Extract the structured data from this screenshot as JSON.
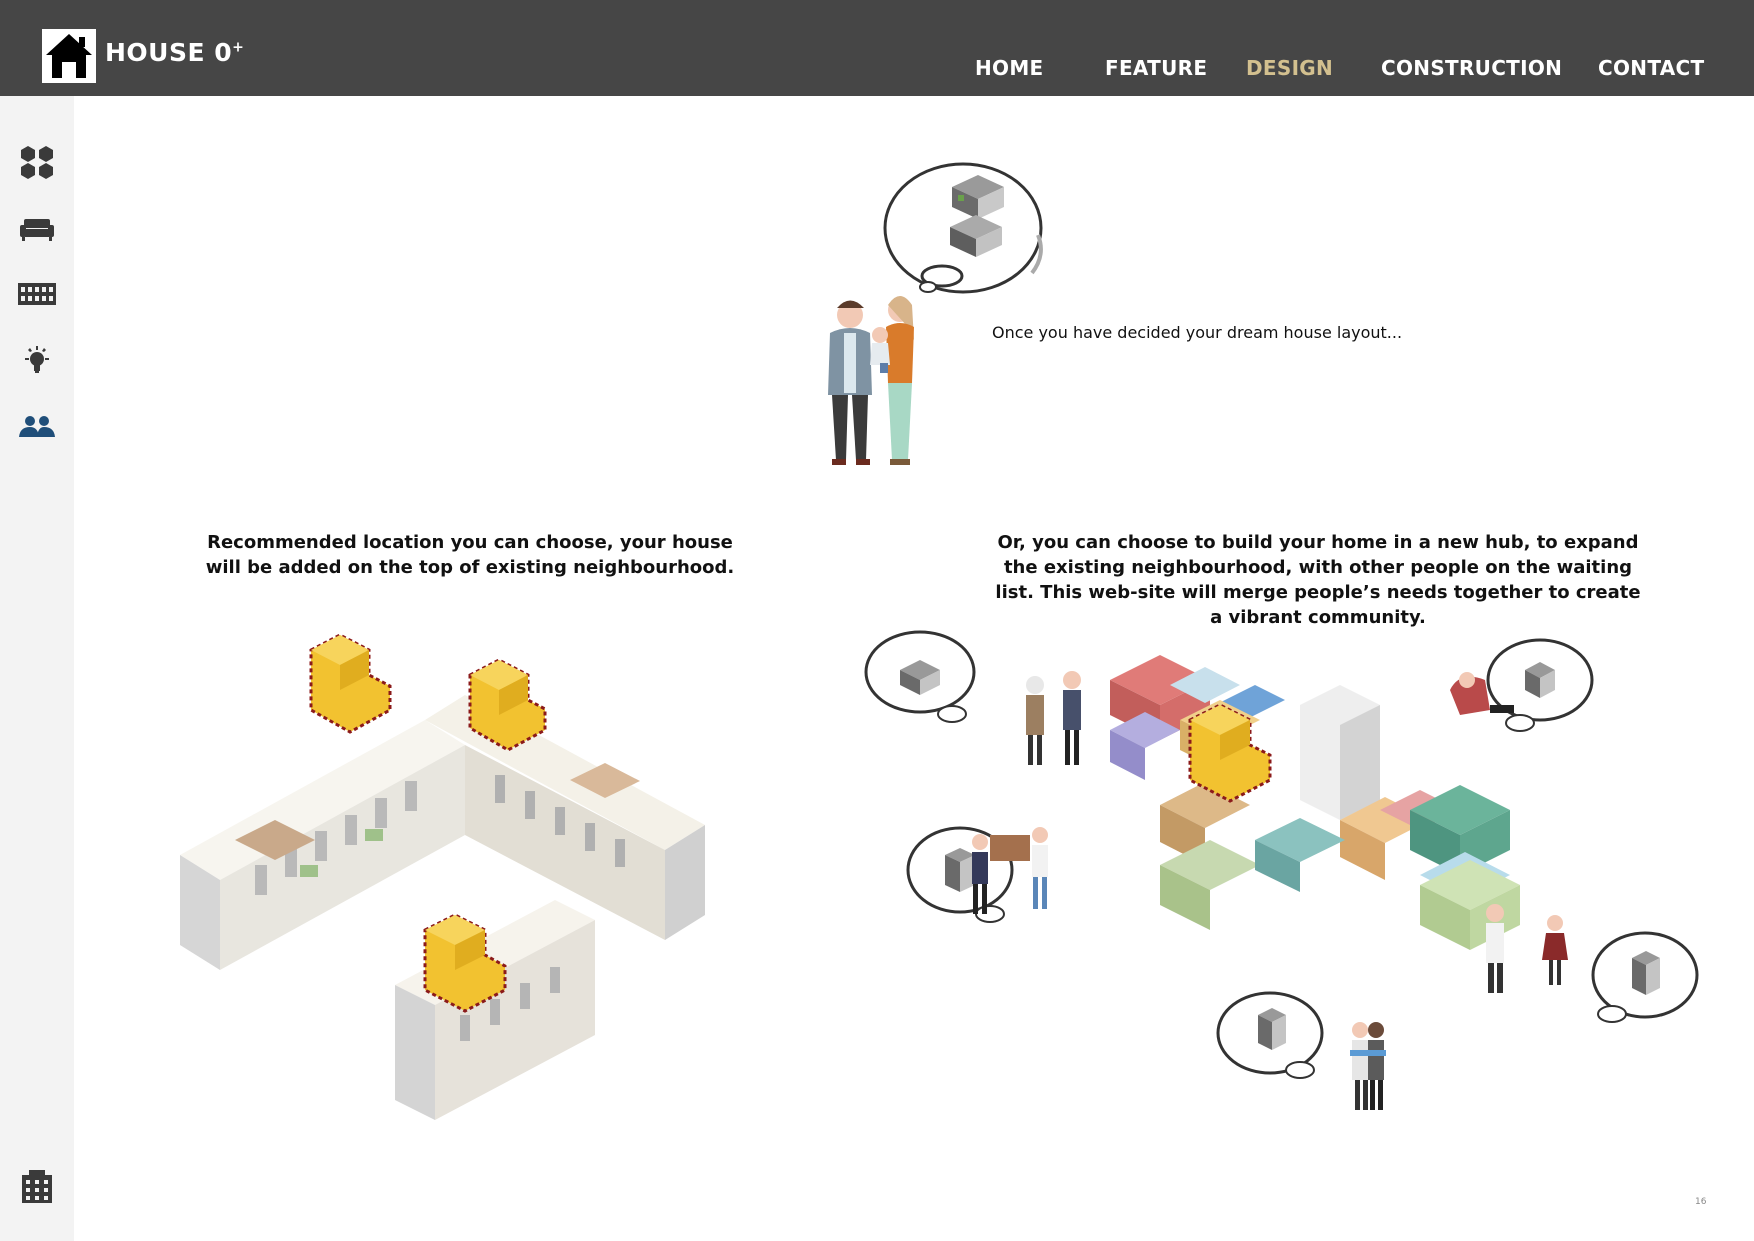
{
  "header": {
    "logo_text": "HOUSE 0",
    "logo_sup": "+",
    "nav": [
      {
        "label": "HOME",
        "active": false
      },
      {
        "label": "FEATURE",
        "active": false
      },
      {
        "label": "DESIGN",
        "active": true
      },
      {
        "label": "CONSTRUCTION",
        "active": false
      },
      {
        "label": "CONTACT",
        "active": false
      }
    ],
    "active_color": "#d3c08f",
    "bar_color": "#464646"
  },
  "sidebar": {
    "items": [
      {
        "icon": "cubes-icon"
      },
      {
        "icon": "sofa-icon"
      },
      {
        "icon": "facade-icon"
      },
      {
        "icon": "lightbulb-icon"
      },
      {
        "icon": "people-icon",
        "active": true
      },
      {
        "icon": "building-icon"
      }
    ],
    "active_color": "#1f4e79"
  },
  "main": {
    "intro_text": "Once you have decided your dream house layout...",
    "left_caption": "Recommended location you can choose, your house will be added on the top of existing neighbourhood.",
    "right_caption": "Or, you can choose to build your home in a new hub, to expand the existing neighbourhood, with other people on the waiting list. This web-site will merge people’s needs together to create a vibrant community.",
    "highlight_color": "#f2c230",
    "outline_color": "#8b1a1a"
  },
  "footer": {
    "page_number": "16"
  }
}
